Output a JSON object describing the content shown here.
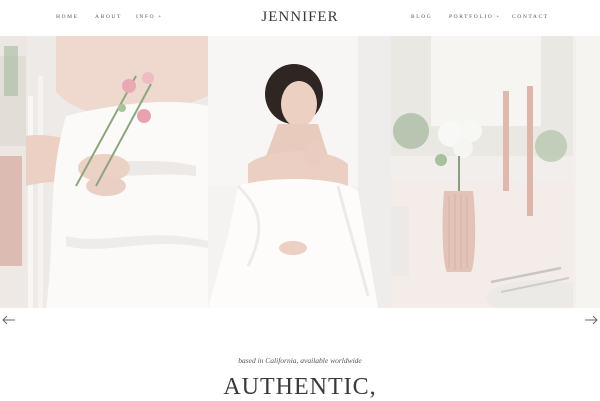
{
  "nav": {
    "left": [
      {
        "label": "HOME"
      },
      {
        "label": "ABOUT"
      },
      {
        "label": "INFO"
      }
    ],
    "right": [
      {
        "label": "BLOG"
      },
      {
        "label": "PORTFOLIO"
      },
      {
        "label": "CONTACT"
      }
    ],
    "caret": "+"
  },
  "brand": {
    "name": "JENNIFER"
  },
  "hero": {
    "tagline": "based in California, available worldwide",
    "headline": "AUTHENTIC,"
  },
  "colors": {
    "accent_blush": "#d9b6ae",
    "text": "#3a3a3a",
    "background": "#ffffff"
  },
  "icons": {
    "prev": "arrow-left-icon",
    "next": "arrow-right-icon"
  }
}
